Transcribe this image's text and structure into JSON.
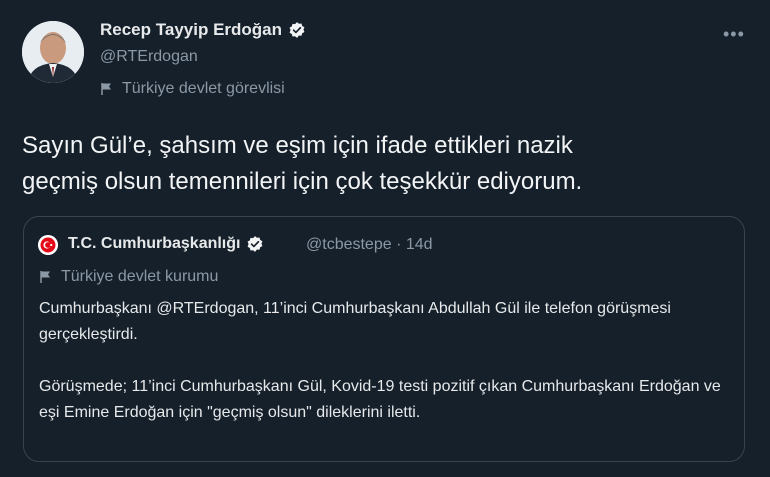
{
  "tweet": {
    "author_name": "Recep Tayyip Erdoğan",
    "author_handle": "@RTErdogan",
    "account_label": "Türkiye devlet görevlisi",
    "more_icon": "more-horizontal-icon",
    "text": "Sayın Gül’e, şahsım ve eşim için ifade ettikleri nazik\ngeçmiş olsun temennileri için çok teşekkür ediyorum."
  },
  "quoted": {
    "author_name": "T.C. Cumhurbaşkanlığı",
    "handle": "@tcbestepe",
    "separator": "·",
    "time": "14d",
    "account_label": "Türkiye devlet kurumu",
    "paragraph1": "Cumhurbaşkanı @RTErdogan, 11’inci Cumhurbaşkanı Abdullah Gül ile telefon görüşmesi gerçekleştirdi.",
    "paragraph2": "Görüşmede; 11’inci Cumhurbaşkanı Gül, Kovid-19 testi pozitif çıkan Cumhurbaşkanı Erdoğan ve eşi Emine Erdoğan için \"geçmiş olsun\" dileklerini iletti."
  },
  "colors": {
    "background": "#15202b",
    "border": "#38444d",
    "secondary_text": "#8b98a5",
    "primary_text": "#e7e9ea"
  }
}
